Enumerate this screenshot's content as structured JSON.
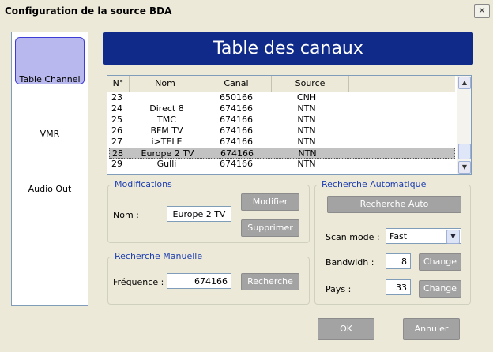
{
  "window": {
    "title": "Configuration de la source BDA",
    "close_glyph": "✕"
  },
  "sidebar": {
    "items": [
      {
        "label": "Table Channel",
        "active": true
      },
      {
        "label": "VMR",
        "active": false
      },
      {
        "label": "Audio Out",
        "active": false
      }
    ]
  },
  "banner": {
    "title": "Table des canaux"
  },
  "table": {
    "headers": [
      "N°",
      "Nom",
      "Canal",
      "Source"
    ],
    "rows": [
      {
        "num": "23",
        "nom": "",
        "canal": "650166",
        "source": "CNH"
      },
      {
        "num": "24",
        "nom": "Direct 8",
        "canal": "674166",
        "source": "NTN"
      },
      {
        "num": "25",
        "nom": "TMC",
        "canal": "674166",
        "source": "NTN"
      },
      {
        "num": "26",
        "nom": "BFM TV",
        "canal": "674166",
        "source": "NTN"
      },
      {
        "num": "27",
        "nom": "i>TELE",
        "canal": "674166",
        "source": "NTN"
      },
      {
        "num": "28",
        "nom": "Europe 2 TV",
        "canal": "674166",
        "source": "NTN",
        "selected": true
      },
      {
        "num": "29",
        "nom": "Gulli",
        "canal": "674166",
        "source": "NTN"
      }
    ],
    "scroll_up_glyph": "▲",
    "scroll_down_glyph": "▼"
  },
  "modifications": {
    "legend": "Modifications",
    "nom_label": "Nom :",
    "nom_value": "Europe 2 TV",
    "modifier_label": "Modifier",
    "supprimer_label": "Supprimer"
  },
  "manuelle": {
    "legend": "Recherche Manuelle",
    "freq_label": "Fréquence :",
    "freq_value": "674166",
    "recherche_label": "Recherche"
  },
  "auto": {
    "legend": "Recherche Automatique",
    "recherche_auto_label": "Recherche Auto",
    "scan_label": "Scan mode :",
    "scan_value": "Fast",
    "dropdown_glyph": "▼",
    "bandwidth_label": "Bandwidh :",
    "bandwidth_value": "8",
    "pays_label": "Pays :",
    "pays_value": "33",
    "change_label": "Change"
  },
  "footer": {
    "ok_label": "OK",
    "annuler_label": "Annuler"
  },
  "colors": {
    "banner_bg": "#102a8a",
    "active_tab_bg": "#b8b8ef",
    "legend_text": "#1f3fb0",
    "button_bg": "#a3a3a3"
  }
}
